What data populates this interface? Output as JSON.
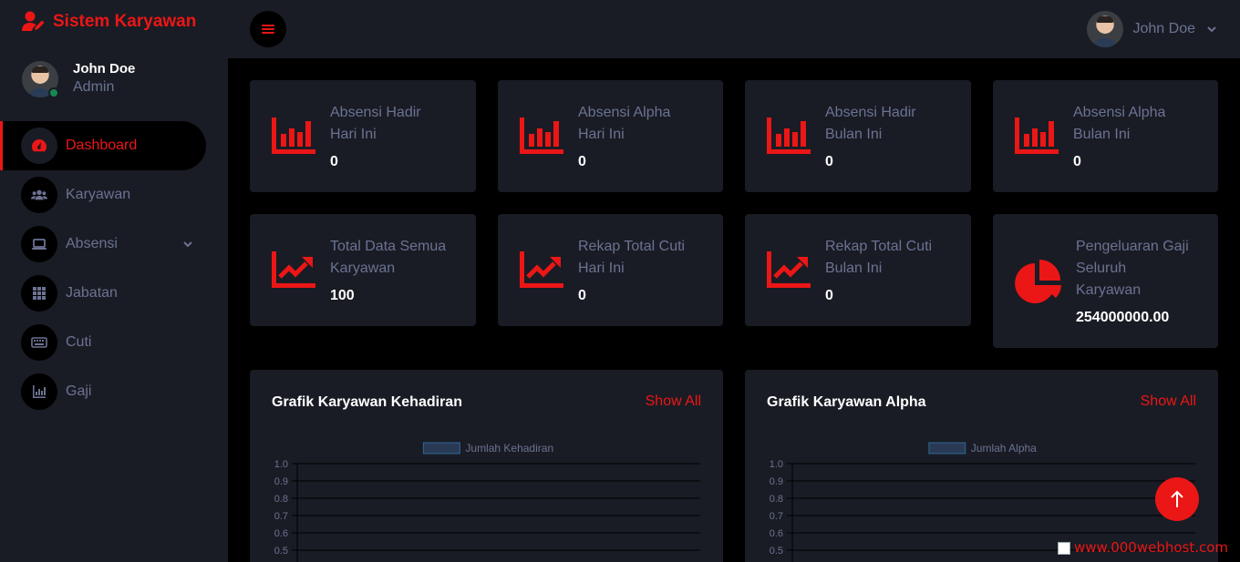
{
  "brand": {
    "title": "Sistem Karyawan",
    "color": "#eb1616",
    "icon": "user-edit-icon"
  },
  "profile": {
    "name": "John Doe",
    "role": "Admin",
    "status": "online"
  },
  "sidebar": {
    "items": [
      {
        "label": "Dashboard",
        "icon": "tachometer-icon",
        "active": true
      },
      {
        "label": "Karyawan",
        "icon": "users-icon"
      },
      {
        "label": "Absensi",
        "icon": "laptop-icon",
        "has_submenu": true
      },
      {
        "label": "Jabatan",
        "icon": "th-grid-icon"
      },
      {
        "label": "Cuti",
        "icon": "keyboard-icon"
      },
      {
        "label": "Gaji",
        "icon": "chart-bar-icon"
      }
    ]
  },
  "topbar": {
    "user_name": "John Doe",
    "toggle_icon": "bars-icon"
  },
  "stats": [
    {
      "label_line1": "Absensi Hadir",
      "label_line2": "Hari Ini",
      "value": "0",
      "icon": "chart-bar-icon"
    },
    {
      "label_line1": "Absensi Alpha",
      "label_line2": "Hari Ini",
      "value": "0",
      "icon": "chart-bar-icon"
    },
    {
      "label_line1": "Absensi Hadir",
      "label_line2": "Bulan Ini",
      "value": "0",
      "icon": "chart-bar-icon"
    },
    {
      "label_line1": "Absensi Alpha",
      "label_line2": "Bulan Ini",
      "value": "0",
      "icon": "chart-bar-icon"
    },
    {
      "label_line1": "Total Data Semua",
      "label_line2": "Karyawan",
      "value": "100",
      "icon": "chart-line-icon"
    },
    {
      "label_line1": "Rekap Total Cuti",
      "label_line2": "Hari Ini",
      "value": "0",
      "icon": "chart-line-icon"
    },
    {
      "label_line1": "Rekap Total Cuti",
      "label_line2": "Bulan Ini",
      "value": "0",
      "icon": "chart-line-icon"
    },
    {
      "label_line1": "Pengeluaran Gaji",
      "label_line2": "Seluruh",
      "label_line3": "Karyawan",
      "value": "254000000.00",
      "icon": "chart-pie-icon"
    }
  ],
  "charts": [
    {
      "title": "Grafik Karyawan Kehadiran",
      "show_all": "Show All"
    },
    {
      "title": "Grafik Karyawan Alpha",
      "show_all": "Show All"
    }
  ],
  "chart_data": [
    {
      "type": "bar",
      "series": [
        {
          "name": "Jumlah Kehadiran",
          "values": []
        }
      ],
      "categories": [],
      "y_ticks": [
        "1.0",
        "0.9",
        "0.8",
        "0.7",
        "0.6",
        "0.5"
      ],
      "ylim": [
        0,
        1.0
      ],
      "legend": "top",
      "grid": true
    },
    {
      "type": "bar",
      "series": [
        {
          "name": "Jumlah Alpha",
          "values": []
        }
      ],
      "categories": [],
      "y_ticks": [
        "1.0",
        "0.9",
        "0.8",
        "0.7",
        "0.6",
        "0.5"
      ],
      "ylim": [
        0,
        1.0
      ],
      "legend": "top",
      "grid": true
    }
  ],
  "footer": {
    "host_text": "www.000webhost.com"
  },
  "colors": {
    "accent": "#eb1616",
    "panel": "#191c24",
    "bg": "#000000",
    "muted": "#6c7293"
  }
}
